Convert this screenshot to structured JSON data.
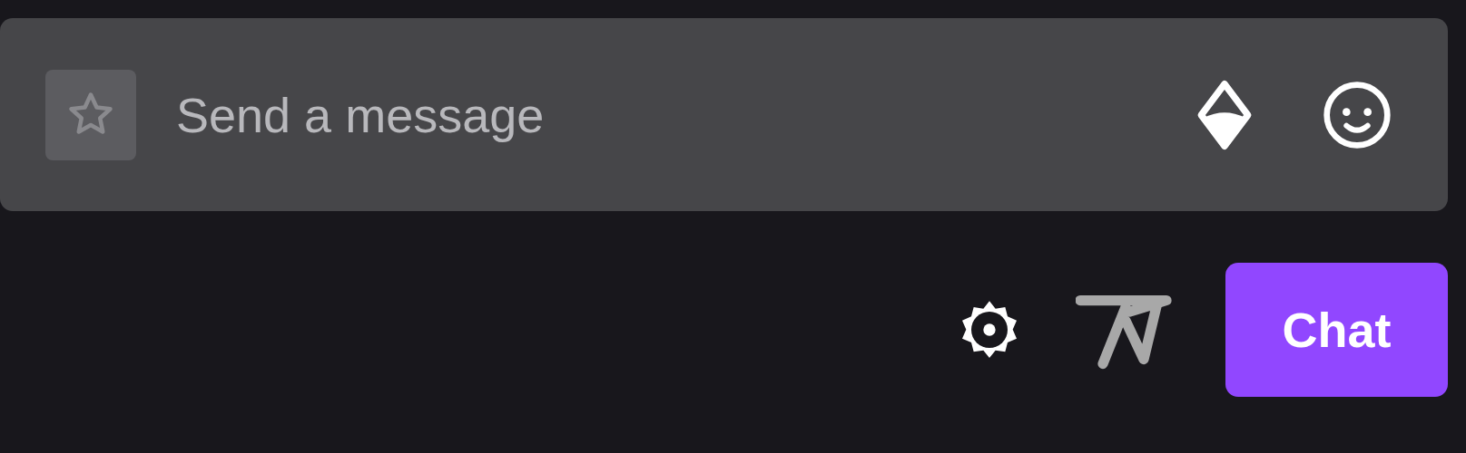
{
  "chat_input": {
    "placeholder": "Send a message"
  },
  "chat_button": {
    "label": "Chat"
  }
}
